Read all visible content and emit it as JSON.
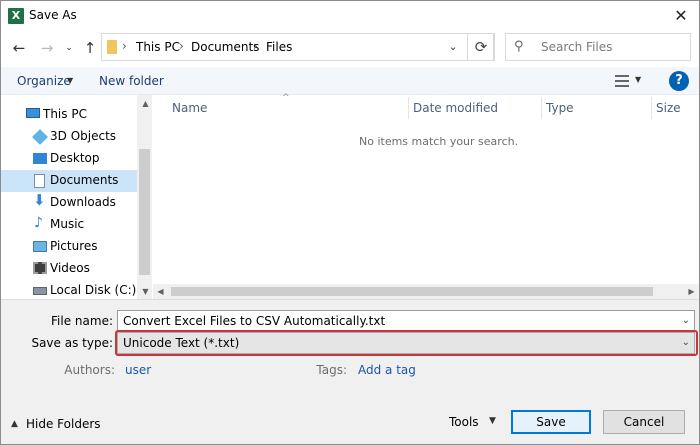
{
  "window": {
    "title": "Save As"
  },
  "nav": {
    "breadcrumb": [
      "This PC",
      "Documents",
      "Files"
    ],
    "search_placeholder": "Search Files"
  },
  "toolbar": {
    "organize_label": "Organize",
    "new_folder_label": "New folder"
  },
  "sidebar": {
    "items": [
      {
        "label": "This PC",
        "icon": "pc-icon"
      },
      {
        "label": "3D Objects",
        "icon": "3d-objects-icon"
      },
      {
        "label": "Desktop",
        "icon": "desktop-icon"
      },
      {
        "label": "Documents",
        "icon": "documents-icon",
        "selected": true
      },
      {
        "label": "Downloads",
        "icon": "downloads-icon"
      },
      {
        "label": "Music",
        "icon": "music-icon"
      },
      {
        "label": "Pictures",
        "icon": "pictures-icon"
      },
      {
        "label": "Videos",
        "icon": "videos-icon"
      },
      {
        "label": "Local Disk (C:)",
        "icon": "drive-icon"
      }
    ]
  },
  "file_list": {
    "columns": [
      "Name",
      "Date modified",
      "Type",
      "Size"
    ],
    "empty_message": "No items match your search."
  },
  "form": {
    "file_name_label": "File name:",
    "file_name_value": "Convert Excel Files to CSV Automatically.txt",
    "save_type_label": "Save as type:",
    "save_type_value": "Unicode Text (*.txt)",
    "authors_label": "Authors:",
    "authors_value": "user",
    "tags_label": "Tags:",
    "tags_value": "Add a tag"
  },
  "footer": {
    "hide_folders_label": "Hide Folders",
    "tools_label": "Tools",
    "save_label": "Save",
    "cancel_label": "Cancel"
  },
  "colors": {
    "accent": "#0078d7",
    "highlight_border": "#c8363b",
    "selection": "#cce4f7",
    "excel_green": "#1e7145"
  }
}
